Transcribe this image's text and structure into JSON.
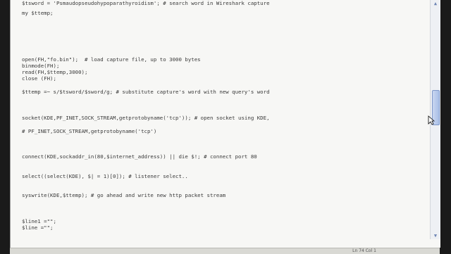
{
  "editor": {
    "lines": [
      "$tsword = 'Psmaudopseudohypoparathyroidism'; # search word in Wireshark capture",
      "my $ttemp;",
      "open(FH,\"fo.bin\");  # load capture file, up to 3000 bytes",
      "binmode(FH);",
      "read(FH,$ttemp,3000);",
      "close (FH);",
      "$ttemp =~ s/$tsword/$sword/g; # substitute capture's word with new query's word",
      "socket(KDE,PF_INET,SOCK_STREAM,getprotobyname('tcp')); # open socket using KDE,",
      "# PF_INET,SOCK_STREAM,getprotobyname('tcp')",
      "connect(KDE,sockaddr_in(80,$internet_address)) || die $!; # connect port 80",
      "select((select(KDE), $| = 1)[0]); # listener select..",
      "syswrite(KDE,$ttemp); # go ahead and write new http packet stream",
      "$line1 =\"\";",
      "$line =\"\";"
    ]
  },
  "scrollbar": {
    "up_icon": "scroll-up-arrow-icon",
    "down_icon": "scroll-down-arrow-icon"
  },
  "status": {
    "text": "Ln 74 Col 1"
  }
}
